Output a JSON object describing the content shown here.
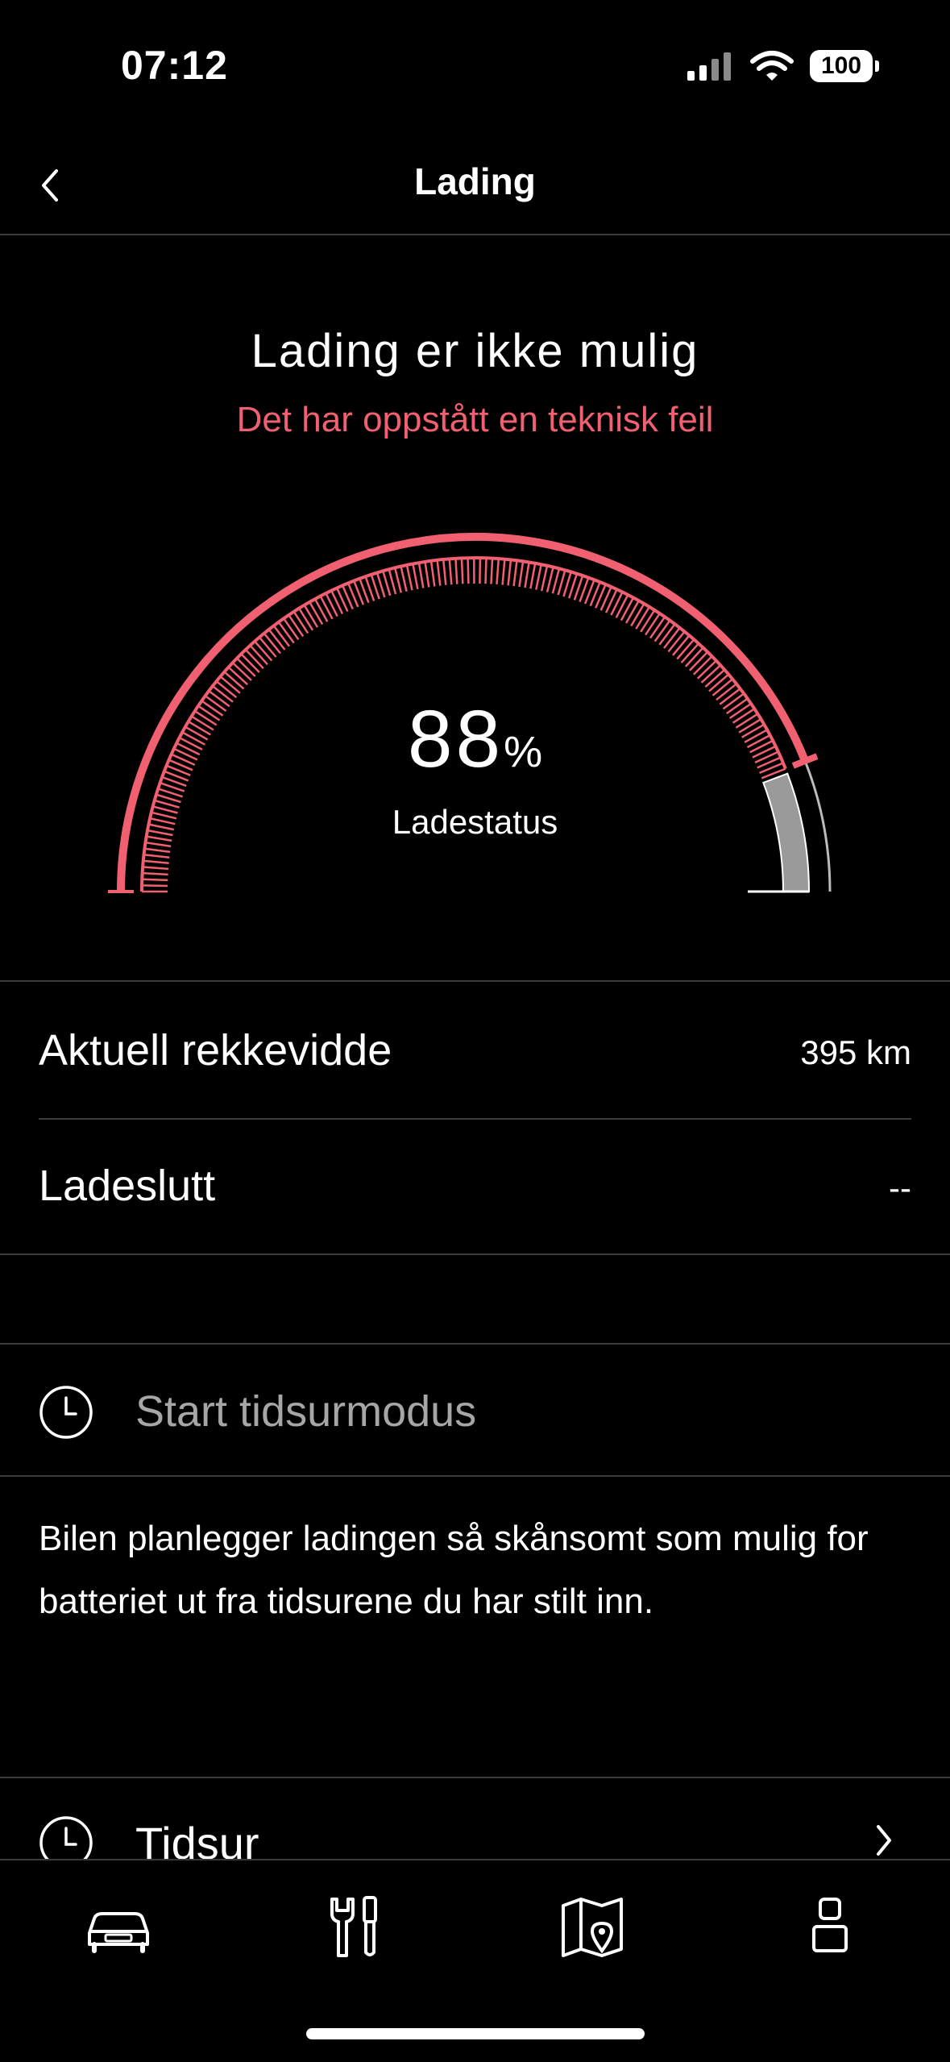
{
  "status_bar": {
    "time": "07:12",
    "battery": "100",
    "icons": [
      "cellular-signal-icon",
      "wifi-icon",
      "battery-icon"
    ]
  },
  "nav": {
    "title": "Lading",
    "back_icon": "chevron-left-icon"
  },
  "charge": {
    "headline": "Lading er ikke mulig",
    "error": "Det har oppstått en teknisk feil",
    "percent": "88",
    "unit": "%",
    "label": "Ladestatus",
    "level_fraction": 0.88
  },
  "info_rows": [
    {
      "label": "Aktuell rekkevidde",
      "value": "395 km"
    },
    {
      "label": "Ladeslutt",
      "value": "--"
    }
  ],
  "timer_mode": {
    "label": "Start tidsurmodus",
    "icon": "clock-icon",
    "description": "Bilen planlegger ladingen så skånsomt som mulig for batteriet ut fra tidsurene du har stilt inn."
  },
  "timer": {
    "label": "Tidsur",
    "icon": "clock-icon",
    "chevron": "chevron-right-icon"
  },
  "tabs": [
    {
      "icon": "car-icon"
    },
    {
      "icon": "tools-icon"
    },
    {
      "icon": "map-icon"
    },
    {
      "icon": "profile-icon"
    }
  ],
  "colors": {
    "accent": "#f06070",
    "background": "#000000",
    "divider": "#3a3a3a",
    "muted_text": "#a6a6a6",
    "remaining": "#9a9a9a"
  }
}
